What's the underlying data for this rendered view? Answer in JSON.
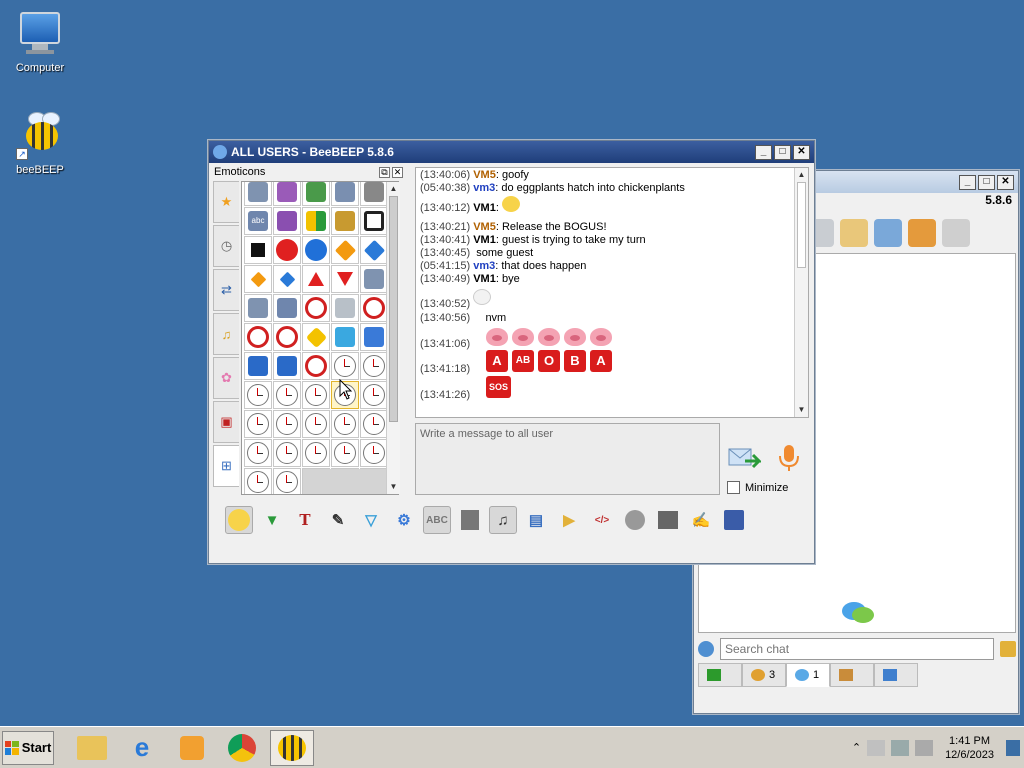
{
  "desktop": {
    "icons": [
      {
        "label": "Computer"
      },
      {
        "label": "beeBEEP"
      }
    ]
  },
  "back_window": {
    "version": "5.8.6",
    "search_placeholder": "Search chat",
    "tabs": [
      {
        "label": ""
      },
      {
        "label": "3"
      },
      {
        "label": "1"
      },
      {
        "label": ""
      },
      {
        "label": ""
      }
    ]
  },
  "main_window": {
    "title": "ALL USERS - BeeBEEP 5.8.6",
    "emoticons_label": "Emoticons",
    "compose_placeholder": "Write a message to all user",
    "minimize_label": "Minimize"
  },
  "chat": {
    "messages": [
      {
        "time": "(13:40:06)",
        "user": "VM5",
        "text": "goofy"
      },
      {
        "time": "(05:40:38)",
        "user": "vm3",
        "text": "do eggplants hatch into chickenplants"
      },
      {
        "time": "(13:40:12)",
        "user": "VM1",
        "text": ""
      },
      {
        "time": "(13:40:21)",
        "user": "VM5",
        "text": "Release the BOGUS!"
      },
      {
        "time": "(13:40:41)",
        "user": "VM1",
        "text": "guest is trying to take my turn"
      },
      {
        "time": "(13:40:45)",
        "user": "",
        "text": "some guest"
      },
      {
        "time": "(05:41:15)",
        "user": "vm3",
        "text": "that does happen"
      },
      {
        "time": "(13:40:49)",
        "user": "VM1",
        "text": "bye"
      },
      {
        "time": "(13:40:52)",
        "user": "",
        "text": ""
      },
      {
        "time": "(13:40:56)",
        "user": "",
        "text": "nvm"
      },
      {
        "time": "(13:41:06)",
        "user": "",
        "text": ""
      },
      {
        "time": "(13:41:18)",
        "user": "",
        "text": ""
      },
      {
        "time": "(13:41:26)",
        "user": "",
        "text": ""
      }
    ],
    "blood_labels": [
      "A",
      "AB",
      "O",
      "B",
      "A"
    ],
    "sos_label": "SOS"
  },
  "taskbar": {
    "start_label": "Start",
    "time": "1:41 PM",
    "date": "12/6/2023"
  }
}
